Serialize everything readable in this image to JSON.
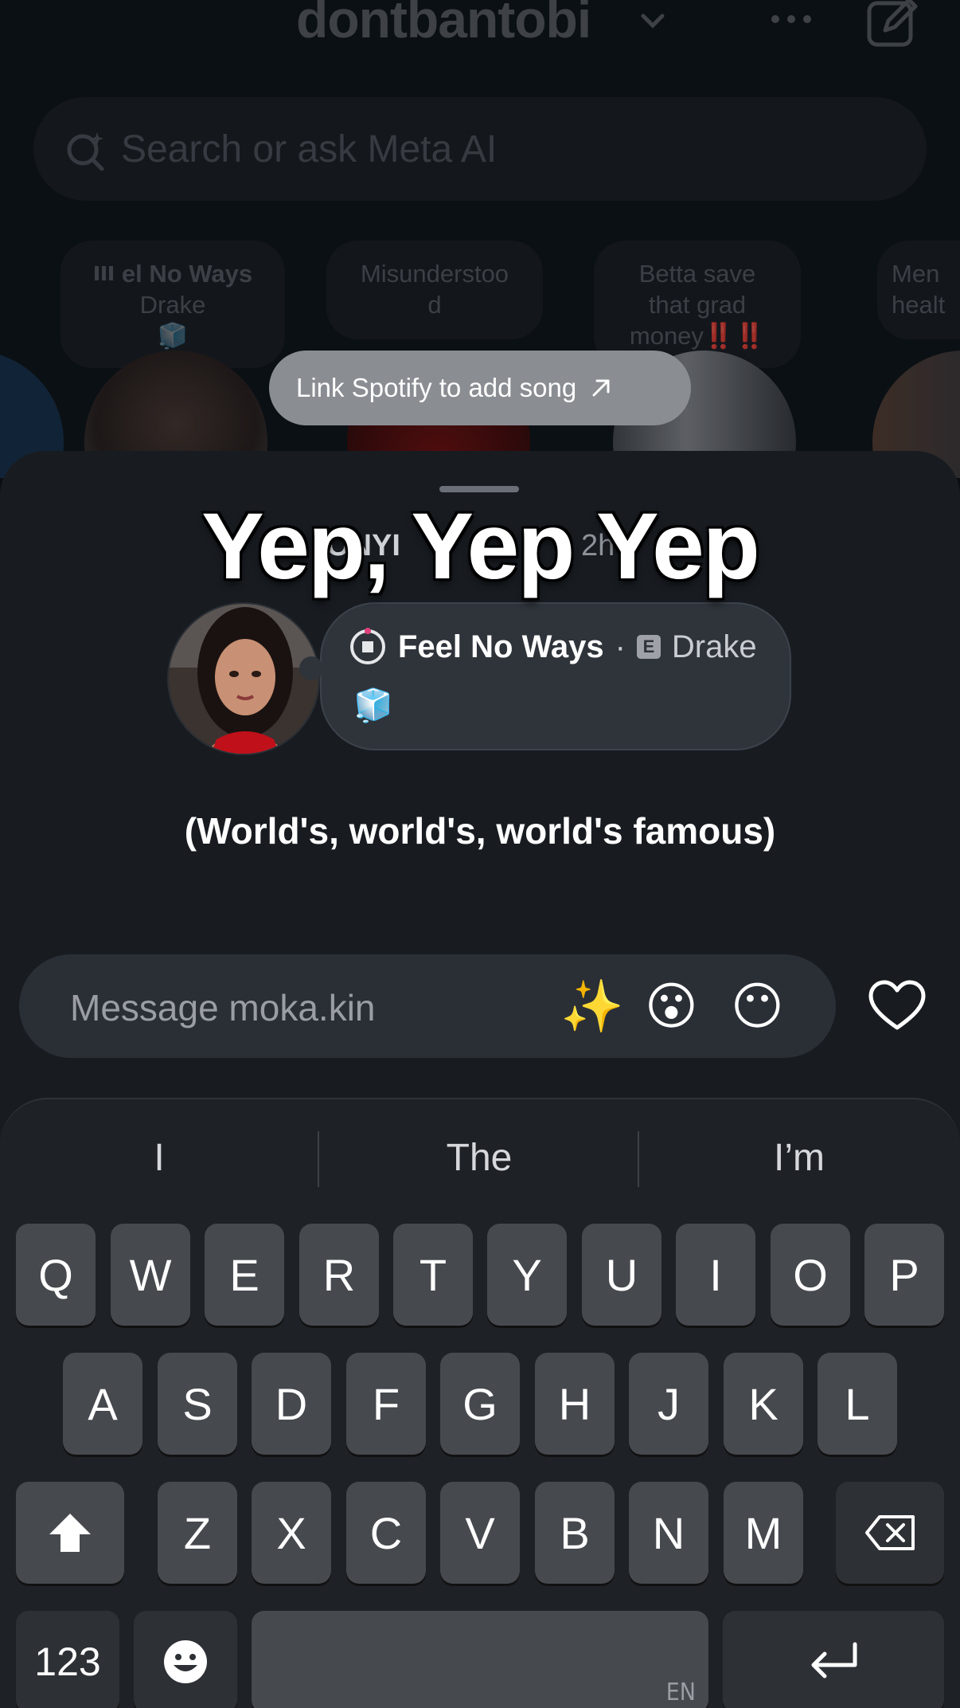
{
  "header": {
    "username": "dontbantobi"
  },
  "search": {
    "placeholder": "Search or ask Meta AI"
  },
  "notes": [
    {
      "line1": "el No Ways",
      "line2": "Drake",
      "line3": "🧊",
      "playing": true
    },
    {
      "line1": "Misunderstoo",
      "line2": "d"
    },
    {
      "line1": "Betta save",
      "line2": "that grad",
      "line3": "money‼️‼️"
    },
    {
      "line1": "Men",
      "line2": "healt"
    }
  ],
  "spotify_pill": {
    "label": "Link Spotify to add song"
  },
  "sheet": {
    "user": "ONYI",
    "time": "2h",
    "lyric_big": "Yep, Yep Yep",
    "song": {
      "title": "Feel No Ways",
      "separator": "·",
      "explicit_badge": "E",
      "artist": "Drake",
      "emoji": "🧊"
    },
    "lyric_line": "(World's, world's, world's famous)"
  },
  "message": {
    "placeholder": "Message moka.kin",
    "quick_reactions": [
      "✨",
      "😮",
      "😶"
    ]
  },
  "keyboard": {
    "suggestions": [
      "I",
      "The",
      "I’m"
    ],
    "row1": [
      "Q",
      "W",
      "E",
      "R",
      "T",
      "Y",
      "U",
      "I",
      "O",
      "P"
    ],
    "row2": [
      "A",
      "S",
      "D",
      "F",
      "G",
      "H",
      "J",
      "K",
      "L"
    ],
    "row3": [
      "Z",
      "X",
      "C",
      "V",
      "B",
      "N",
      "M"
    ],
    "numbers_label": "123",
    "language": "EN"
  },
  "colors": {
    "background": "#0b0f14",
    "sheet": "#181c21",
    "key": "#46494e"
  }
}
